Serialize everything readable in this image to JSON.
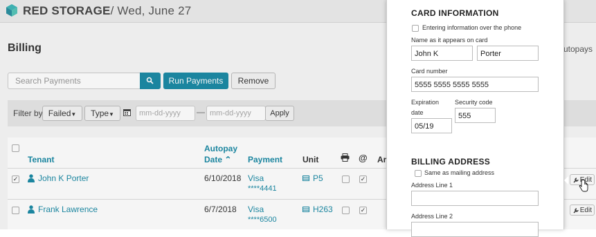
{
  "header": {
    "brand": "RED STORAGE",
    "date": "/ Wed, June 27"
  },
  "page": {
    "title": "Billing",
    "autopays_label": "Autopays"
  },
  "toolbar": {
    "search_placeholder": "Search Payments",
    "run_label": "Run Payments",
    "remove_label": "Remove"
  },
  "filters": {
    "label": "Filter by",
    "failed_label": "Failed",
    "type_label": "Type",
    "date_placeholder": "mm-dd-yyyy",
    "dash": "—",
    "apply_label": "Apply"
  },
  "table": {
    "headers": {
      "tenant": "Tenant",
      "autopay_line1": "Autopay",
      "autopay_line2": "Date",
      "payment": "Payment",
      "unit": "Unit",
      "amount_partial": "Ar"
    },
    "rows": [
      {
        "checked": true,
        "tenant": "John K Porter",
        "date": "6/10/2018",
        "payment_type": "Visa",
        "payment_last4": "****4441",
        "unit": "P5",
        "print": false,
        "email": true
      },
      {
        "checked": false,
        "tenant": "Frank Lawrence",
        "date": "6/7/2018",
        "payment_type": "Visa",
        "payment_last4": "****6500",
        "unit": "H263",
        "print": false,
        "email": true
      }
    ],
    "edit_label": "Edit"
  },
  "modal": {
    "card_title": "CARD INFORMATION",
    "phone_label": "Entering information over the phone",
    "name_label": "Name as it appears on card",
    "first_name": "John K",
    "last_name": "Porter",
    "card_number_label": "Card number",
    "card_number": "5555 5555 5555 5555",
    "expiration_label_1": "Expiration",
    "expiration_label_2": "date",
    "expiration": "05/19",
    "security_label": "Security code",
    "security_code": "555",
    "billing_title": "BILLING ADDRESS",
    "same_as_mailing_label": "Same as mailing address",
    "address1_label": "Address Line 1",
    "address1": "",
    "address2_label": "Address Line 2",
    "address2": ""
  },
  "colors": {
    "accent": "#1a8aa5",
    "logo": "#2aa7b0"
  }
}
